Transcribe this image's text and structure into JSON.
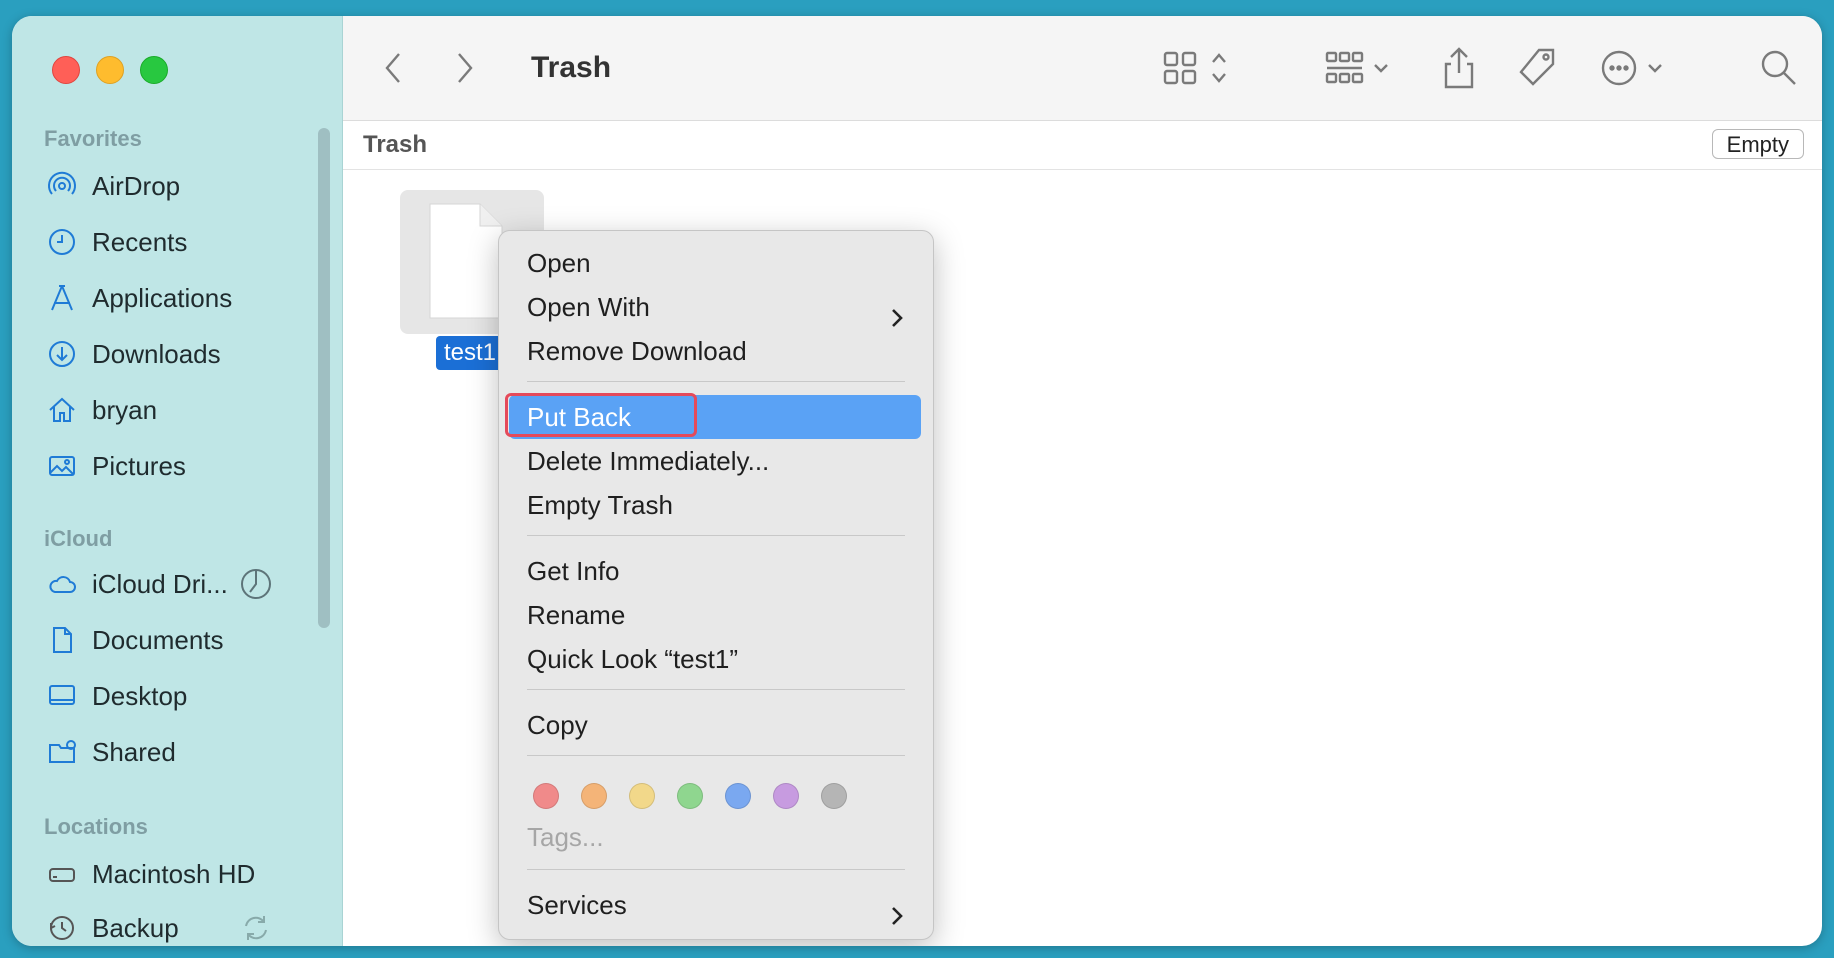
{
  "window": {
    "title": "Trash"
  },
  "sidebar": {
    "sections": [
      {
        "label": "Favorites"
      },
      {
        "label": "iCloud"
      },
      {
        "label": "Locations"
      }
    ],
    "items": [
      {
        "label": "AirDrop",
        "icon": "airdrop-icon"
      },
      {
        "label": "Recents",
        "icon": "clock-icon"
      },
      {
        "label": "Applications",
        "icon": "applications-icon"
      },
      {
        "label": "Downloads",
        "icon": "download-icon"
      },
      {
        "label": "bryan",
        "icon": "home-icon"
      },
      {
        "label": "Pictures",
        "icon": "pictures-icon"
      },
      {
        "label": "iCloud Dri...",
        "icon": "cloud-icon"
      },
      {
        "label": "Documents",
        "icon": "document-icon"
      },
      {
        "label": "Desktop",
        "icon": "desktop-icon"
      },
      {
        "label": "Shared",
        "icon": "shared-folder-icon"
      },
      {
        "label": "Macintosh HD",
        "icon": "disk-icon"
      },
      {
        "label": "Backup",
        "icon": "backup-icon"
      }
    ]
  },
  "pathbar": {
    "label": "Trash",
    "empty_button": "Empty"
  },
  "file": {
    "name": "test1"
  },
  "context_menu": {
    "items": {
      "open": "Open",
      "open_with": "Open With",
      "remove_download": "Remove Download",
      "put_back": "Put Back",
      "delete_immediately": "Delete Immediately...",
      "empty_trash": "Empty Trash",
      "get_info": "Get Info",
      "rename": "Rename",
      "quick_look": "Quick Look “test1”",
      "copy": "Copy",
      "tags": "Tags...",
      "services": "Services"
    },
    "tag_colors": [
      "#f08a8a",
      "#f4b478",
      "#f2d88a",
      "#8fd68f",
      "#7aa8f0",
      "#c79be0",
      "#b5b5b5"
    ]
  },
  "colors": {
    "accent": "#1b6fd6",
    "highlight": "#5aa2f5",
    "annotation": "#e54a5a"
  }
}
